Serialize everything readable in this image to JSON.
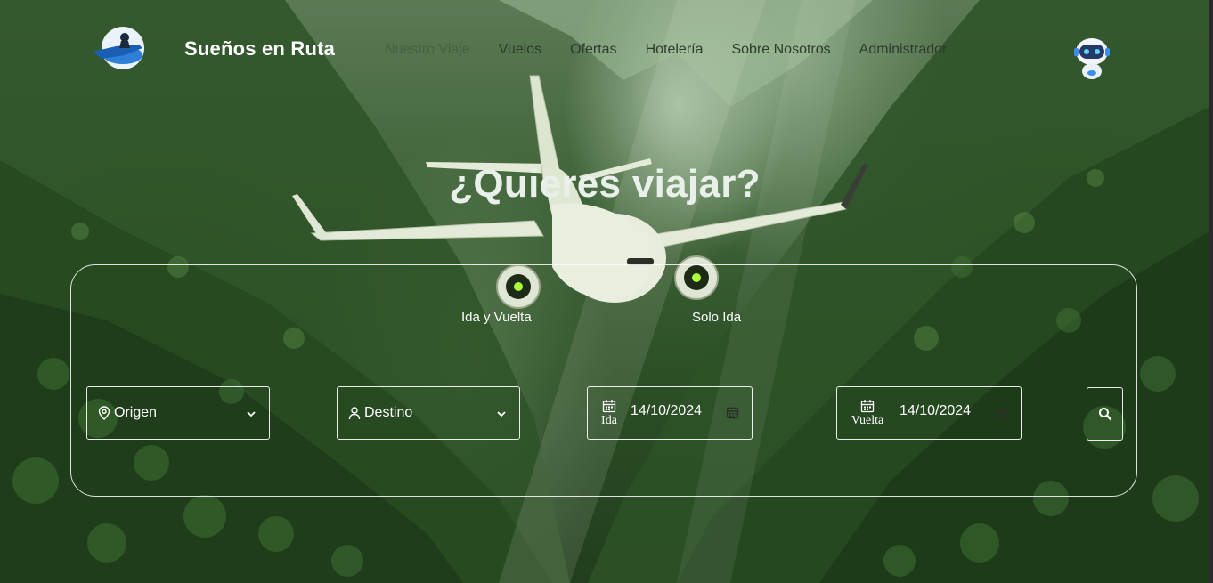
{
  "brand": {
    "name": "Sueños en Ruta"
  },
  "nav": {
    "items": [
      {
        "label": "Nuestro Viaje"
      },
      {
        "label": "Vuelos"
      },
      {
        "label": "Ofertas"
      },
      {
        "label": "Hotelería"
      },
      {
        "label": "Sobre Nosotros"
      },
      {
        "label": "Administrador"
      }
    ]
  },
  "hero": {
    "title": "¿Quieres viajar?"
  },
  "search": {
    "trip_types": [
      {
        "label": "Ida y Vuelta"
      },
      {
        "label": "Solo Ida"
      }
    ],
    "origin": {
      "label": "Origen",
      "icon": "map-pin-icon"
    },
    "destination": {
      "label": "Destino",
      "icon": "user-icon"
    },
    "departure": {
      "caption": "Ida",
      "value": "14/10/2024",
      "icon": "calendar-icon"
    },
    "return": {
      "caption": "Vuelta",
      "value": "14/10/2024",
      "icon": "calendar-icon"
    },
    "submit_icon": "search-icon"
  },
  "colors": {
    "nav_text": "#2e3b2c",
    "hero_title": "#e9f0ea",
    "card_border": "#ffffff"
  }
}
